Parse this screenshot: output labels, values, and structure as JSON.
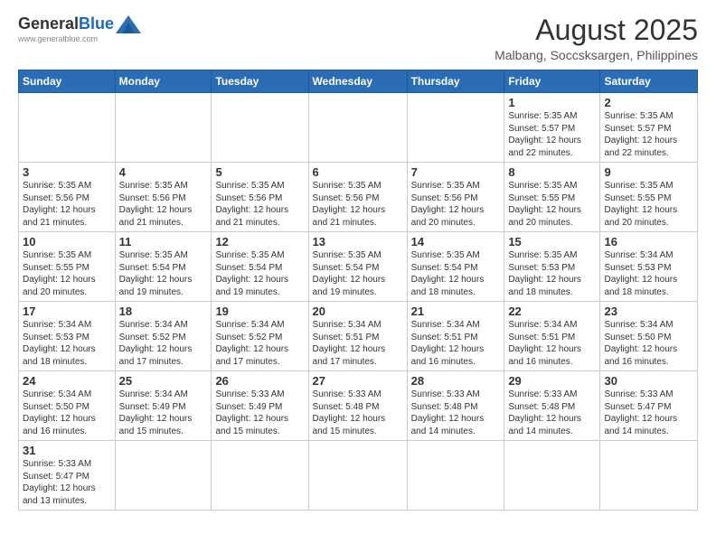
{
  "header": {
    "logo": {
      "general": "General",
      "blue": "Blue",
      "tagline": "www.generalblue.com"
    },
    "title": "August 2025",
    "location": "Malbang, Soccsksargen, Philippines"
  },
  "days_of_week": [
    "Sunday",
    "Monday",
    "Tuesday",
    "Wednesday",
    "Thursday",
    "Friday",
    "Saturday"
  ],
  "weeks": [
    {
      "days": [
        {
          "number": "",
          "info": "",
          "empty": true
        },
        {
          "number": "",
          "info": "",
          "empty": true
        },
        {
          "number": "",
          "info": "",
          "empty": true
        },
        {
          "number": "",
          "info": "",
          "empty": true
        },
        {
          "number": "",
          "info": "",
          "empty": true
        },
        {
          "number": "1",
          "info": "Sunrise: 5:35 AM\nSunset: 5:57 PM\nDaylight: 12 hours\nand 22 minutes."
        },
        {
          "number": "2",
          "info": "Sunrise: 5:35 AM\nSunset: 5:57 PM\nDaylight: 12 hours\nand 22 minutes."
        }
      ]
    },
    {
      "days": [
        {
          "number": "3",
          "info": "Sunrise: 5:35 AM\nSunset: 5:56 PM\nDaylight: 12 hours\nand 21 minutes."
        },
        {
          "number": "4",
          "info": "Sunrise: 5:35 AM\nSunset: 5:56 PM\nDaylight: 12 hours\nand 21 minutes."
        },
        {
          "number": "5",
          "info": "Sunrise: 5:35 AM\nSunset: 5:56 PM\nDaylight: 12 hours\nand 21 minutes."
        },
        {
          "number": "6",
          "info": "Sunrise: 5:35 AM\nSunset: 5:56 PM\nDaylight: 12 hours\nand 21 minutes."
        },
        {
          "number": "7",
          "info": "Sunrise: 5:35 AM\nSunset: 5:56 PM\nDaylight: 12 hours\nand 20 minutes."
        },
        {
          "number": "8",
          "info": "Sunrise: 5:35 AM\nSunset: 5:55 PM\nDaylight: 12 hours\nand 20 minutes."
        },
        {
          "number": "9",
          "info": "Sunrise: 5:35 AM\nSunset: 5:55 PM\nDaylight: 12 hours\nand 20 minutes."
        }
      ]
    },
    {
      "days": [
        {
          "number": "10",
          "info": "Sunrise: 5:35 AM\nSunset: 5:55 PM\nDaylight: 12 hours\nand 20 minutes."
        },
        {
          "number": "11",
          "info": "Sunrise: 5:35 AM\nSunset: 5:54 PM\nDaylight: 12 hours\nand 19 minutes."
        },
        {
          "number": "12",
          "info": "Sunrise: 5:35 AM\nSunset: 5:54 PM\nDaylight: 12 hours\nand 19 minutes."
        },
        {
          "number": "13",
          "info": "Sunrise: 5:35 AM\nSunset: 5:54 PM\nDaylight: 12 hours\nand 19 minutes."
        },
        {
          "number": "14",
          "info": "Sunrise: 5:35 AM\nSunset: 5:54 PM\nDaylight: 12 hours\nand 18 minutes."
        },
        {
          "number": "15",
          "info": "Sunrise: 5:35 AM\nSunset: 5:53 PM\nDaylight: 12 hours\nand 18 minutes."
        },
        {
          "number": "16",
          "info": "Sunrise: 5:34 AM\nSunset: 5:53 PM\nDaylight: 12 hours\nand 18 minutes."
        }
      ]
    },
    {
      "days": [
        {
          "number": "17",
          "info": "Sunrise: 5:34 AM\nSunset: 5:53 PM\nDaylight: 12 hours\nand 18 minutes."
        },
        {
          "number": "18",
          "info": "Sunrise: 5:34 AM\nSunset: 5:52 PM\nDaylight: 12 hours\nand 17 minutes."
        },
        {
          "number": "19",
          "info": "Sunrise: 5:34 AM\nSunset: 5:52 PM\nDaylight: 12 hours\nand 17 minutes."
        },
        {
          "number": "20",
          "info": "Sunrise: 5:34 AM\nSunset: 5:51 PM\nDaylight: 12 hours\nand 17 minutes."
        },
        {
          "number": "21",
          "info": "Sunrise: 5:34 AM\nSunset: 5:51 PM\nDaylight: 12 hours\nand 16 minutes."
        },
        {
          "number": "22",
          "info": "Sunrise: 5:34 AM\nSunset: 5:51 PM\nDaylight: 12 hours\nand 16 minutes."
        },
        {
          "number": "23",
          "info": "Sunrise: 5:34 AM\nSunset: 5:50 PM\nDaylight: 12 hours\nand 16 minutes."
        }
      ]
    },
    {
      "days": [
        {
          "number": "24",
          "info": "Sunrise: 5:34 AM\nSunset: 5:50 PM\nDaylight: 12 hours\nand 16 minutes."
        },
        {
          "number": "25",
          "info": "Sunrise: 5:34 AM\nSunset: 5:49 PM\nDaylight: 12 hours\nand 15 minutes."
        },
        {
          "number": "26",
          "info": "Sunrise: 5:33 AM\nSunset: 5:49 PM\nDaylight: 12 hours\nand 15 minutes."
        },
        {
          "number": "27",
          "info": "Sunrise: 5:33 AM\nSunset: 5:48 PM\nDaylight: 12 hours\nand 15 minutes."
        },
        {
          "number": "28",
          "info": "Sunrise: 5:33 AM\nSunset: 5:48 PM\nDaylight: 12 hours\nand 14 minutes."
        },
        {
          "number": "29",
          "info": "Sunrise: 5:33 AM\nSunset: 5:48 PM\nDaylight: 12 hours\nand 14 minutes."
        },
        {
          "number": "30",
          "info": "Sunrise: 5:33 AM\nSunset: 5:47 PM\nDaylight: 12 hours\nand 14 minutes."
        }
      ]
    },
    {
      "days": [
        {
          "number": "31",
          "info": "Sunrise: 5:33 AM\nSunset: 5:47 PM\nDaylight: 12 hours\nand 13 minutes."
        },
        {
          "number": "",
          "info": "",
          "empty": true
        },
        {
          "number": "",
          "info": "",
          "empty": true
        },
        {
          "number": "",
          "info": "",
          "empty": true
        },
        {
          "number": "",
          "info": "",
          "empty": true
        },
        {
          "number": "",
          "info": "",
          "empty": true
        },
        {
          "number": "",
          "info": "",
          "empty": true
        }
      ]
    }
  ]
}
